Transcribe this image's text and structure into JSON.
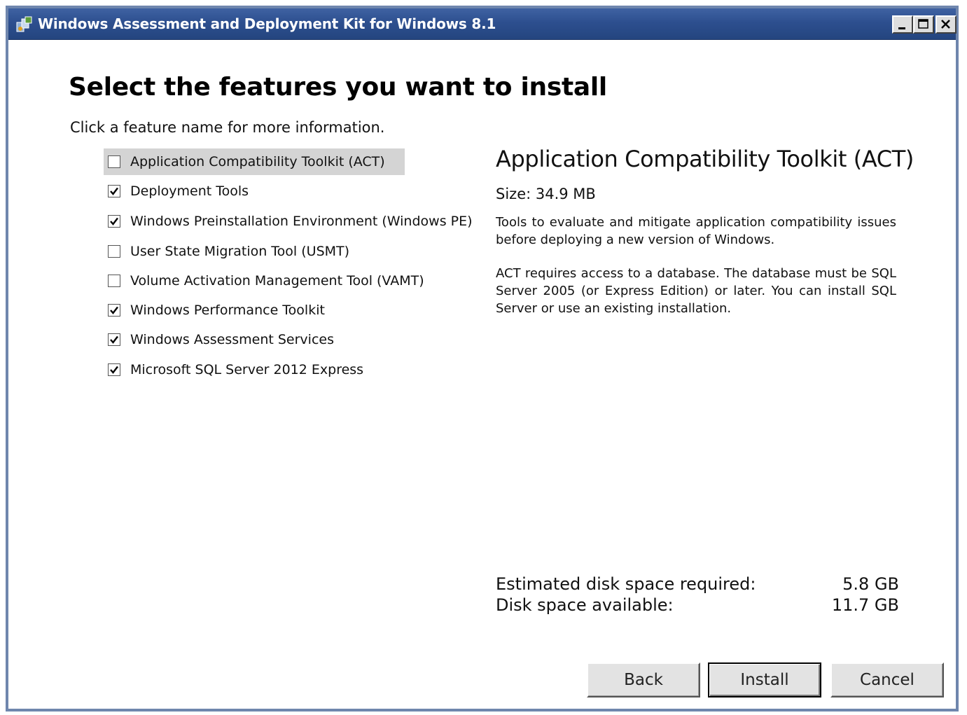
{
  "window": {
    "title": "Windows Assessment and Deployment Kit for Windows 8.1"
  },
  "page": {
    "heading": "Select the features you want to install",
    "subheading": "Click a feature name for more information."
  },
  "features": [
    {
      "label": "Application Compatibility Toolkit (ACT)",
      "checked": false,
      "selected": true
    },
    {
      "label": "Deployment Tools",
      "checked": true,
      "selected": false
    },
    {
      "label": "Windows Preinstallation Environment (Windows PE)",
      "checked": true,
      "selected": false
    },
    {
      "label": "User State Migration Tool (USMT)",
      "checked": false,
      "selected": false
    },
    {
      "label": "Volume Activation Management Tool (VAMT)",
      "checked": false,
      "selected": false
    },
    {
      "label": "Windows Performance Toolkit",
      "checked": true,
      "selected": false
    },
    {
      "label": "Windows Assessment Services",
      "checked": true,
      "selected": false
    },
    {
      "label": "Microsoft SQL Server 2012 Express",
      "checked": true,
      "selected": false
    }
  ],
  "details": {
    "title": "Application Compatibility Toolkit (ACT)",
    "size": "Size: 34.9 MB",
    "description1": "Tools to evaluate and mitigate application compatibility issues before deploying a new version of Windows.",
    "description2": "ACT requires access to a database. The database must be SQL Server 2005 (or Express Edition) or later. You can install SQL Server or use an existing installation."
  },
  "disk": {
    "required_label": "Estimated disk space required:",
    "required_value": "5.8 GB",
    "available_label": "Disk space available:",
    "available_value": "11.7 GB"
  },
  "buttons": {
    "back": "Back",
    "install": "Install",
    "cancel": "Cancel"
  },
  "colors": {
    "titlebar": "#2d4f8f",
    "selected_row": "#d4d4d4",
    "button_face": "#e3e3e3"
  }
}
